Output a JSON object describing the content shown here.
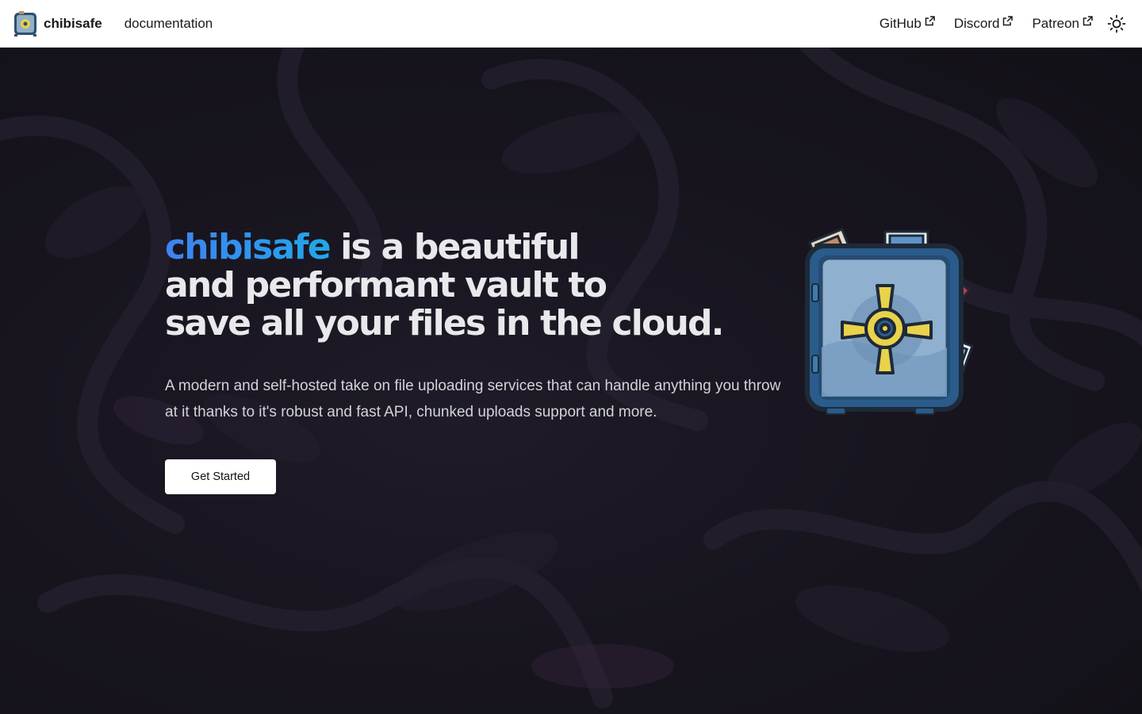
{
  "header": {
    "brand": "chibisafe",
    "documentation": "documentation",
    "links": [
      {
        "label": "GitHub",
        "icon": "external-link-icon"
      },
      {
        "label": "Discord",
        "icon": "external-link-icon"
      },
      {
        "label": "Patreon",
        "icon": "external-link-icon"
      }
    ],
    "theme_toggle_icon": "sun-icon"
  },
  "hero": {
    "title_accent": "chibisafe",
    "title_line1_rest": " is a beautiful",
    "title_line2": "and performant vault to",
    "title_line3": "save all your files in the cloud.",
    "subtitle": "A modern and self-hosted take on file uploading services that can handle anything you throw at it thanks to it's robust and fast API, chunked uploads support and more.",
    "cta_label": "Get Started",
    "illustration": "safe-vault-illustration"
  },
  "colors": {
    "accent_gradient_start": "#3f82f0",
    "accent_gradient_end": "#21a7ea",
    "background": "#16131c",
    "header_bg": "#ffffff"
  }
}
